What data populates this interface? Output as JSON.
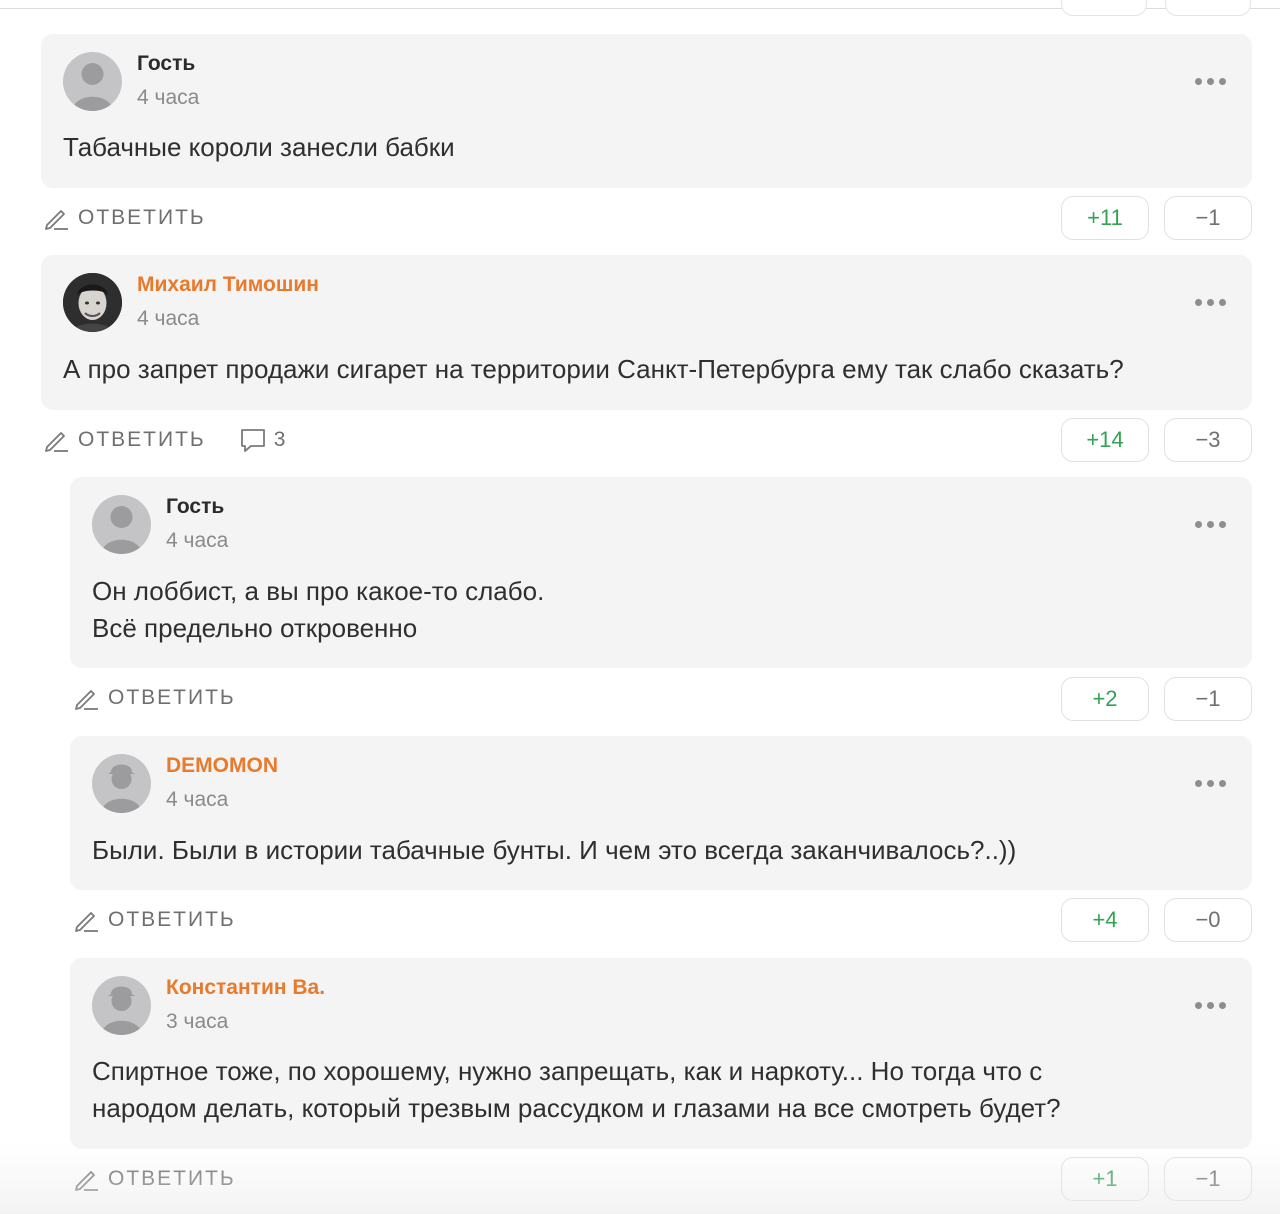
{
  "comments": [
    {
      "author": "Гость",
      "time": "4 часа",
      "text_lines": [
        "Табачные короли занесли бабки"
      ],
      "reply_label": "ОТВЕТИТЬ",
      "votes_up": "+11",
      "votes_down": "−1"
    },
    {
      "author": "Михаил Тимошин",
      "time": "4 часа",
      "text_lines": [
        "А про запрет продажи сигарет на территории Санкт-Петербурга ему так слабо сказать?"
      ],
      "reply_label": "ОТВЕТИТЬ",
      "replies_count": "3",
      "votes_up": "+14",
      "votes_down": "−3"
    },
    {
      "author": "Гость",
      "time": "4 часа",
      "text_lines": [
        "Он лоббист, а вы про какое-то слабо.",
        "Всё предельно откровенно"
      ],
      "reply_label": "ОТВЕТИТЬ",
      "votes_up": "+2",
      "votes_down": "−1"
    },
    {
      "author": "DEMOMON",
      "time": "4 часа",
      "text_lines": [
        "Были. Были в истории табачные бунты. И чем это всегда заканчивалось?..))"
      ],
      "reply_label": "ОТВЕТИТЬ",
      "votes_up": "+4",
      "votes_down": "−0"
    },
    {
      "author": "Константин Ва.",
      "time": "3 часа",
      "text_lines": [
        "Спиртное тоже, по хорошему, нужно запрещать, как и наркоту... Но тогда что с",
        "народом делать, который трезвым рассудком и глазами на все смотреть будет?"
      ],
      "reply_label": "ОТВЕТИТЬ",
      "votes_up": "+1",
      "votes_down": "−1"
    }
  ],
  "colors": {
    "card_bg": "#f4f4f5",
    "author_highlight": "#e87a2c",
    "upvote": "#33a156",
    "muted": "#8a8a8a"
  },
  "icons": [
    "user-silhouette-icon",
    "user-photo-avatar",
    "more-dots-icon",
    "pencil-icon",
    "speech-bubble-icon"
  ]
}
